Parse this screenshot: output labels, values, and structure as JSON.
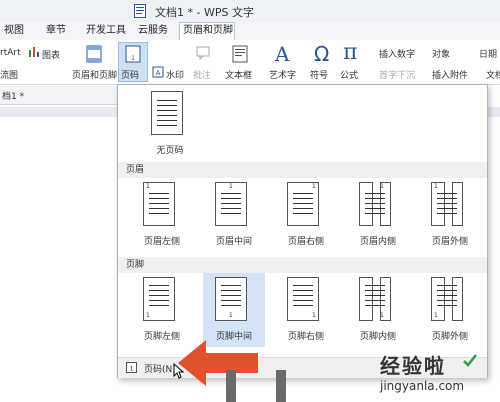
{
  "title": "文档1 * - WPS 文字",
  "menu_tabs": [
    "视图",
    "章节",
    "开发工具",
    "云服务",
    "页眉和页脚"
  ],
  "ribbon": {
    "smartart": "rtArt",
    "chart": "图表",
    "line2_left": "流图",
    "header_footer": "页眉和页脚",
    "page_number": "页码",
    "watermark": "水印",
    "comment": "批注",
    "textbox": "文本框",
    "wordart": "艺术字",
    "symbol": "符号",
    "formula": "公式",
    "insert_number": "插入数字",
    "object": "对象",
    "date": "日期",
    "drop_cap": "首字下沉",
    "insert_attachment": "插入附件",
    "doc": "文档"
  },
  "doc_tab": "档1 *",
  "dropdown": {
    "none_label": "无页码",
    "header_section": "页眉",
    "footer_section": "页脚",
    "header_options": [
      "页眉左侧",
      "页眉中间",
      "页眉右侧",
      "页眉内侧",
      "页眉外侧"
    ],
    "footer_options": [
      "页脚左侧",
      "页脚中间",
      "页脚右侧",
      "页脚内侧",
      "页脚外侧"
    ],
    "page_number_item": "页码(N)...",
    "page_digit": "1"
  },
  "watermark_brand": "经验啦",
  "watermark_url": "jingyanla.com",
  "colors": {
    "selected": "#d4e3f7",
    "arrow": "#e2512e",
    "accent": "#2b5797"
  }
}
